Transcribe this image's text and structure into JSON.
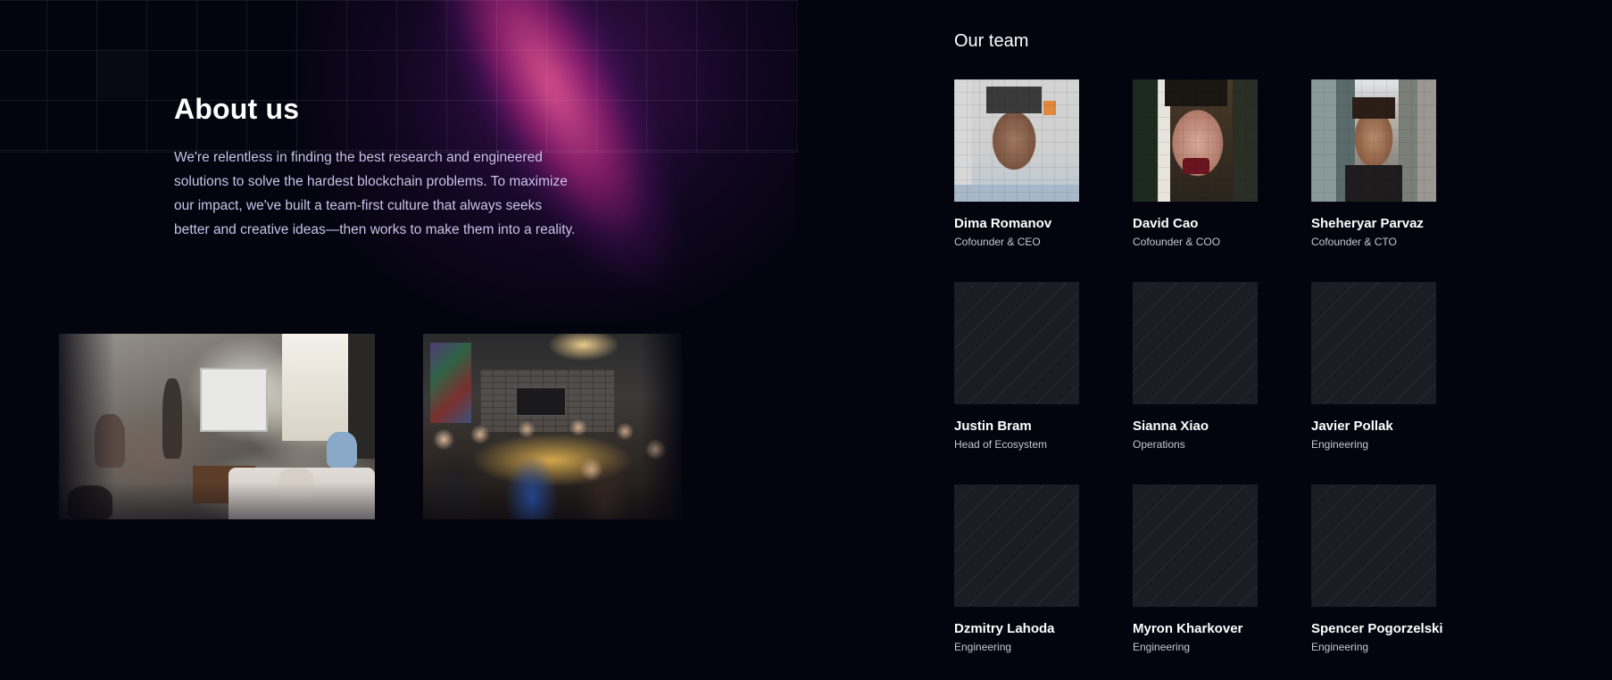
{
  "about": {
    "title": "About us",
    "text": "We're relentless in finding the best research and engineered solutions to solve the hardest blockchain problems. To maximize our impact, we've built a team-first culture that always seeks better and creative ideas—then works to make them into a reality."
  },
  "team": {
    "title": "Our team",
    "members": [
      {
        "name": "Dima Romanov",
        "role": "Cofounder & CEO"
      },
      {
        "name": "David Cao",
        "role": "Cofounder & COO"
      },
      {
        "name": "Sheheryar Parvaz",
        "role": "Cofounder & CTO"
      },
      {
        "name": "Justin Bram",
        "role": "Head of Ecosystem"
      },
      {
        "name": "Sianna Xiao",
        "role": "Operations"
      },
      {
        "name": "Javier Pollak",
        "role": "Engineering"
      },
      {
        "name": "Dzmitry Lahoda",
        "role": "Engineering"
      },
      {
        "name": "Myron Kharkover",
        "role": "Engineering"
      },
      {
        "name": "Spencer Pogorzelski",
        "role": "Engineering"
      }
    ]
  },
  "colors": {
    "background": "#04040f",
    "body_text": "#c9c3e8",
    "glow_pink": "#f05a96",
    "glow_purple": "#6e1482",
    "placeholder": "#1c1c24"
  }
}
